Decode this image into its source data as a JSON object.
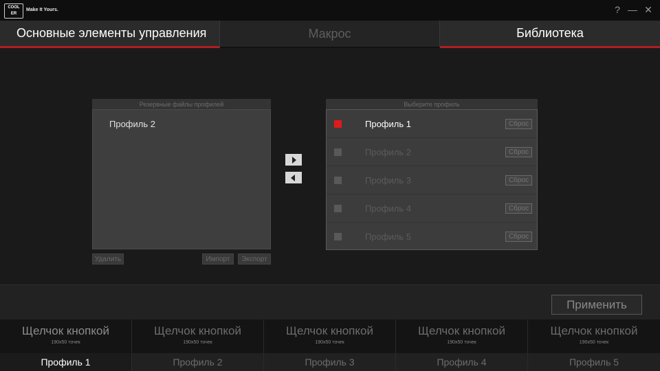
{
  "titlebar": {
    "logo_text": "COOLER MASTER",
    "slogan": "Make It Yours.",
    "help": "?",
    "minimize": "—",
    "close": "✕"
  },
  "tabs": [
    {
      "label": "Основные элементы управления",
      "active": true
    },
    {
      "label": "Макрос",
      "active": false
    },
    {
      "label": "Библиотека",
      "active": true
    }
  ],
  "backup": {
    "header": "Резервные файлы профилей",
    "items": [
      "Профиль 2"
    ],
    "delete_label": "Удалить",
    "import_label": "Импорт",
    "export_label": "Экспорт"
  },
  "transfer": {
    "right_icon": "arrow-right-icon",
    "left_icon": "arrow-left-icon"
  },
  "select_profile": {
    "header": "Выберите профиль",
    "rows": [
      {
        "name": "Профиль 1",
        "checked": true,
        "reset": "Сброс"
      },
      {
        "name": "Профиль 2",
        "checked": false,
        "reset": "Сброс"
      },
      {
        "name": "Профиль 3",
        "checked": false,
        "reset": "Сброс"
      },
      {
        "name": "Профиль 4",
        "checked": false,
        "reset": "Сброс"
      },
      {
        "name": "Профиль 5",
        "checked": false,
        "reset": "Сброс"
      }
    ]
  },
  "apply_label": "Применить",
  "bottom_profiles": [
    {
      "name": "Щелчок кнопкой",
      "resolution": "190x50 точек",
      "label": "Профиль 1",
      "active": true
    },
    {
      "name": "Щелчок кнопкой",
      "resolution": "190x50 точек",
      "label": "Профиль 2",
      "active": false
    },
    {
      "name": "Щелчок кнопкой",
      "resolution": "190x50 точек",
      "label": "Профиль 3",
      "active": false
    },
    {
      "name": "Щелчок кнопкой",
      "resolution": "190x50 точек",
      "label": "Профиль 4",
      "active": false
    },
    {
      "name": "Щелчок кнопкой",
      "resolution": "190x50 точек",
      "label": "Профиль 5",
      "active": false
    }
  ],
  "colors": {
    "accent": "#b01e22",
    "checked": "#e01a1a",
    "background": "#1b1a1a"
  }
}
